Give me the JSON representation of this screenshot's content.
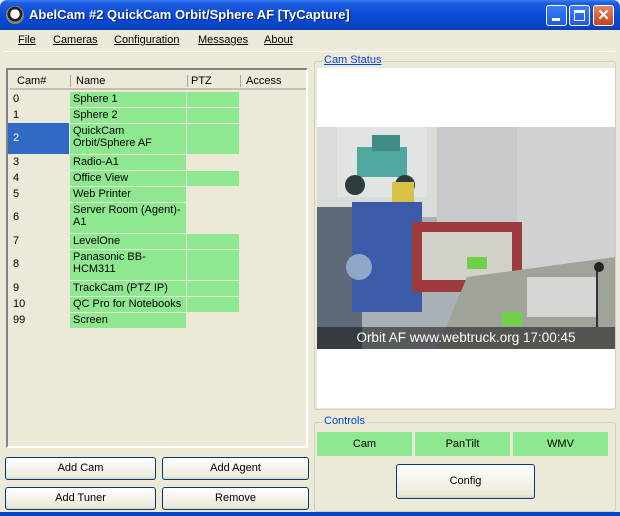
{
  "window": {
    "title": "AbelCam #2 QuickCam Orbit/Sphere AF [TyCapture]",
    "close_glyph": "✕"
  },
  "menu": [
    "File",
    "Cameras",
    "Configuration",
    "Messages",
    "About"
  ],
  "camera_list": {
    "columns": [
      "Cam#",
      "Name",
      "PTZ",
      "Access"
    ],
    "rows": [
      {
        "num": "0",
        "name": "Sphere 1",
        "ptz": true,
        "selected": false
      },
      {
        "num": "1",
        "name": "Sphere 2",
        "ptz": true,
        "selected": false
      },
      {
        "num": "2",
        "name": "QuickCam Orbit/Sphere AF",
        "ptz": true,
        "selected": true
      },
      {
        "num": "3",
        "name": "Radio-A1",
        "ptz": false,
        "selected": false
      },
      {
        "num": "4",
        "name": "Office View",
        "ptz": true,
        "selected": false
      },
      {
        "num": "5",
        "name": "Web Printer",
        "ptz": false,
        "selected": false
      },
      {
        "num": "6",
        "name": "Server Room (Agent)-A1",
        "ptz": false,
        "selected": false
      },
      {
        "num": "7",
        "name": "LevelOne",
        "ptz": true,
        "selected": false
      },
      {
        "num": "8",
        "name": "Panasonic BB-HCM311",
        "ptz": true,
        "selected": false
      },
      {
        "num": "9",
        "name": "TrackCam (PTZ IP)",
        "ptz": true,
        "selected": false
      },
      {
        "num": "10",
        "name": "QC Pro for Notebooks",
        "ptz": true,
        "selected": false
      },
      {
        "num": "99",
        "name": "Screen",
        "ptz": false,
        "selected": false
      }
    ]
  },
  "buttons": {
    "add_cam": "Add Cam",
    "add_agent": "Add Agent",
    "add_tuner": "Add Tuner",
    "remove": "Remove"
  },
  "cam_status": {
    "label": "Cam Status",
    "overlay_text": "Orbit AF www.webtruck.org 17:00:45"
  },
  "controls": {
    "label": "Controls",
    "cam": "Cam",
    "pantilt": "PanTilt",
    "wmv": "WMV",
    "config": "Config"
  },
  "colors": {
    "accent_green": "#8ee88f",
    "selection_blue": "#316ac5",
    "group_label": "#0046d5"
  }
}
